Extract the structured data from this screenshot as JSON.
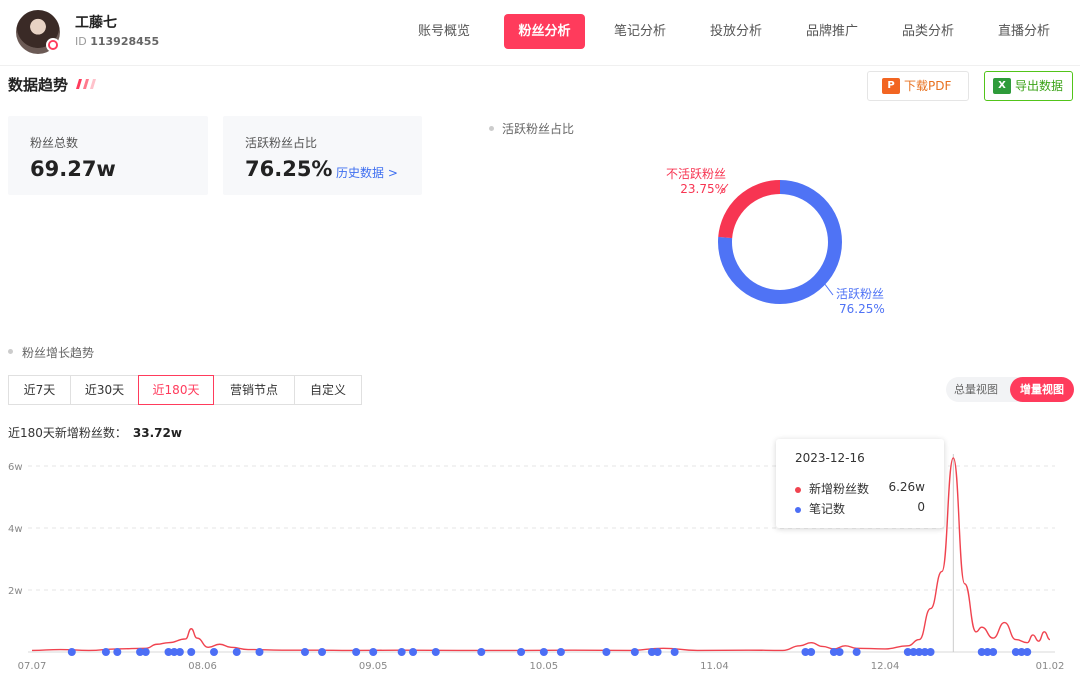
{
  "header": {
    "user_name": "工藤七",
    "user_id_label": "ID",
    "user_id": "113928455",
    "nav": [
      {
        "label": "账号概览",
        "active": false
      },
      {
        "label": "粉丝分析",
        "active": true
      },
      {
        "label": "笔记分析",
        "active": false
      },
      {
        "label": "投放分析",
        "active": false
      },
      {
        "label": "品牌推广",
        "active": false
      },
      {
        "label": "品类分析",
        "active": false
      },
      {
        "label": "直播分析",
        "active": false
      }
    ]
  },
  "section": {
    "title": "数据趋势",
    "download_pdf": "下载PDF",
    "export_data": "导出数据"
  },
  "stats": {
    "total_fans_label": "粉丝总数",
    "total_fans_value": "69.27w",
    "active_ratio_label": "活跃粉丝占比",
    "active_ratio_value": "76.25%",
    "history_link": "历史数据 >"
  },
  "donut": {
    "title": "活跃粉丝占比",
    "inactive_label": "不活跃粉丝",
    "inactive_pct": "23.75%",
    "active_label": "活跃粉丝",
    "active_pct": "76.25%"
  },
  "growth": {
    "title": "粉丝增长趋势",
    "tabs": [
      {
        "label": "近7天",
        "active": false
      },
      {
        "label": "近30天",
        "active": false
      },
      {
        "label": "近180天",
        "active": true
      },
      {
        "label": "营销节点",
        "active": false
      },
      {
        "label": "自定义",
        "active": false
      }
    ],
    "view_total": "总量视图",
    "view_increment": "增量视图",
    "summary_label": "近180天新增粉丝数：",
    "summary_value": "33.72w"
  },
  "tooltip": {
    "date": "2023-12-16",
    "rows": [
      {
        "name": "新增粉丝数",
        "value": "6.26w",
        "color": "#f0434f"
      },
      {
        "name": "笔记数",
        "value": "0",
        "color": "#4c6ef5"
      }
    ]
  },
  "colors": {
    "accent": "#ff3b5c",
    "active_fans": "#4f73f5",
    "inactive_fans": "#f73552",
    "line": "#f0434f",
    "notes": "#4c6ef5"
  },
  "chart_data": [
    {
      "type": "pie",
      "title": "活跃粉丝占比",
      "categories": [
        "不活跃粉丝",
        "活跃粉丝"
      ],
      "values": [
        23.75,
        76.25
      ]
    },
    {
      "type": "line",
      "title": "粉丝增长趋势",
      "y_ticks": [
        "2w",
        "4w",
        "6w"
      ],
      "ylim": [
        0,
        6.5
      ],
      "x_ticks": [
        "07.07",
        "08.06",
        "09.05",
        "10.05",
        "11.04",
        "12.04",
        "01.02"
      ],
      "series": [
        {
          "name": "新增粉丝数",
          "points": [
            [
              "07.07",
              0.05
            ],
            [
              "07.12",
              0.08
            ],
            [
              "07.17",
              0.05
            ],
            [
              "07.22",
              0.1
            ],
            [
              "07.27",
              0.12
            ],
            [
              "07.29",
              0.25
            ],
            [
              "07.31",
              0.3
            ],
            [
              "08.03",
              0.42
            ],
            [
              "08.04",
              0.75
            ],
            [
              "08.05",
              0.45
            ],
            [
              "08.07",
              0.15
            ],
            [
              "08.09",
              0.25
            ],
            [
              "08.11",
              0.15
            ],
            [
              "08.14",
              0.08
            ],
            [
              "08.20",
              0.06
            ],
            [
              "08.26",
              0.06
            ],
            [
              "09.01",
              0.05
            ],
            [
              "09.10",
              0.06
            ],
            [
              "09.20",
              0.05
            ],
            [
              "10.01",
              0.05
            ],
            [
              "10.10",
              0.06
            ],
            [
              "10.20",
              0.05
            ],
            [
              "10.26",
              0.12
            ],
            [
              "11.01",
              0.05
            ],
            [
              "11.10",
              0.06
            ],
            [
              "11.16",
              0.05
            ],
            [
              "11.19",
              0.2
            ],
            [
              "11.21",
              0.3
            ],
            [
              "11.23",
              0.18
            ],
            [
              "11.25",
              0.1
            ],
            [
              "11.27",
              0.2
            ],
            [
              "11.29",
              0.12
            ],
            [
              "12.04",
              0.1
            ],
            [
              "12.08",
              0.2
            ],
            [
              "12.10",
              0.4
            ],
            [
              "12.12",
              1.4
            ],
            [
              "12.14",
              2.6
            ],
            [
              "12.16",
              6.26
            ],
            [
              "12.18",
              2.2
            ],
            [
              "12.20",
              0.65
            ],
            [
              "12.21",
              0.8
            ],
            [
              "12.23",
              0.45
            ],
            [
              "12.25",
              0.95
            ],
            [
              "12.27",
              0.4
            ],
            [
              "12.29",
              0.3
            ],
            [
              "12.30",
              0.55
            ],
            [
              "12.31",
              0.35
            ],
            [
              "01.01",
              0.65
            ],
            [
              "01.02",
              0.4
            ]
          ]
        },
        {
          "name": "笔记数",
          "note_dates": [
            "07.14",
            "07.20",
            "07.22",
            "07.26",
            "07.27",
            "07.31",
            "08.01",
            "08.02",
            "08.04",
            "08.08",
            "08.12",
            "08.16",
            "08.24",
            "08.27",
            "09.02",
            "09.05",
            "09.10",
            "09.12",
            "09.16",
            "09.24",
            "10.01",
            "10.05",
            "10.08",
            "10.16",
            "10.21",
            "10.24",
            "10.25",
            "10.28",
            "11.20",
            "11.21",
            "11.25",
            "11.26",
            "11.29",
            "12.08",
            "12.09",
            "12.10",
            "12.11",
            "12.12",
            "12.21",
            "12.22",
            "12.23",
            "12.27",
            "12.28",
            "12.29"
          ]
        }
      ]
    }
  ]
}
